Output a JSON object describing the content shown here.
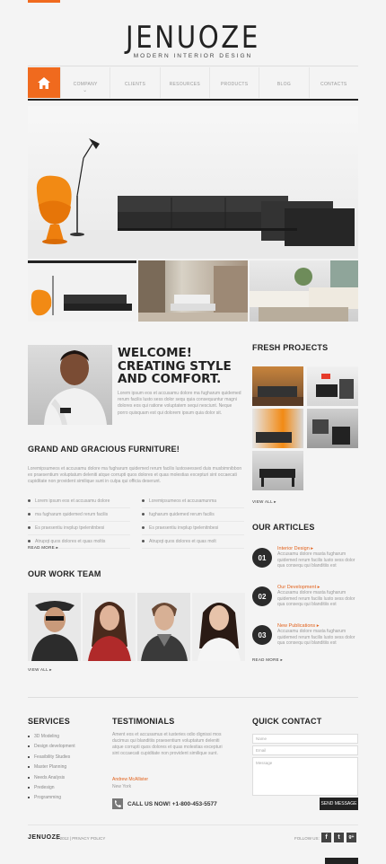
{
  "brand": {
    "logo": "JENUOZE",
    "tagline": "MODERN INTERIOR DESIGN",
    "accent": "#f06a1e"
  },
  "nav": {
    "home_icon": "home-icon",
    "items": [
      "COMPANY",
      "CLIENTS",
      "RESOURCES",
      "PRODUCTS",
      "BLOG",
      "CONTACTS"
    ]
  },
  "welcome": {
    "title_line1": "WELCOME!",
    "title_line2": "CREATING STYLE",
    "title_line3": "AND COMFORT.",
    "text": "Lorem ipsum eos et accusamu dolore ma fugharum quidemed rerum facilis lusto sess dolor sequ quia consequuntur magni dolores eos qui ratione voluptatem sequi nesciunt. Neque porro quisquam est qui dolorem ipsum quia dolor sit."
  },
  "furniture": {
    "title": "GRAND AND GRACIOUS FURNITURE!",
    "text": "Loremipsumeos et accusamu dolore ma fugharum quidemed rerum facilis lustoseessed duis musbimnibbon ex praesentium voluptatum deleniti atque corrupti quos dolores et quas molestias excepturi sint occaecati cupiditate non provident similique sunt in culpa qui officia deserunt.",
    "bullets_left": [
      "Lorem ipsum eos et accusamu dolore",
      "ma fugharum quidemed rerum facilis",
      "Es praesentiu invplup tpelenitnbesi",
      "Atrupqt quos dolores et quas moltis"
    ],
    "bullets_right": [
      "Loremipsumeos et accusamunma",
      "fugharum quidemed rerum facilis",
      "Es praesentiu invplup tpelenitnbesi",
      "Atrupqt quos dolores et quas molt"
    ],
    "more": "READ MORE"
  },
  "team": {
    "title": "OUR WORK TEAM",
    "more": "VIEW ALL"
  },
  "projects": {
    "title": "FRESH PROJECTS",
    "more": "VIEW ALL"
  },
  "articles": {
    "title": "OUR ARTICLES",
    "items": [
      {
        "num": "01",
        "title": "Interior Design",
        "text": "Accusamu dolore masta fugharum quidemed rerum facilis lusto sess dolor qua consequ qui blanditiis est"
      },
      {
        "num": "02",
        "title": "Our Development",
        "text": "Accusamu dolore masta fugharum quidemed rerum facilis lusto sess dolor qua consequ qui blanditiis est"
      },
      {
        "num": "03",
        "title": "New Publications",
        "text": "Accusamu dolore masta fugharum quidemed rerum facilis lusto sess dolor qua consequ qui blanditiis est"
      }
    ],
    "more": "READ MORE"
  },
  "services": {
    "title": "SERVICES",
    "items": [
      "3D Modeling",
      "Design development",
      "Feasibility Studies",
      "Master Planning",
      "Needs Analysis",
      "Predesign",
      "Programming"
    ]
  },
  "testimonials": {
    "title": "TESTIMONIALS",
    "text": "Ament eos et accusamus et iusteries odio dignissi mos ducimus qui blanditiis praesentium voluptatum deleniti atque corrupti quos dolores et quas molestias excepturi sint occaecati cupiditate non provident similique sunt.",
    "author": "Andrew McAllister",
    "location": "New York",
    "call": "CALL US NOW! +1-800-453-5577"
  },
  "contact": {
    "title": "QUICK CONTACT",
    "name_placeholder": "Name",
    "email_placeholder": "Email",
    "message_placeholder": "Message",
    "send": "SEND MESSAGE"
  },
  "footer": {
    "logo": "JENUOZE",
    "copyright": "© 2012 | PRIVACY POLICY",
    "follow": "FOLLOW US:",
    "socials": [
      "f",
      "t",
      "g+"
    ]
  }
}
